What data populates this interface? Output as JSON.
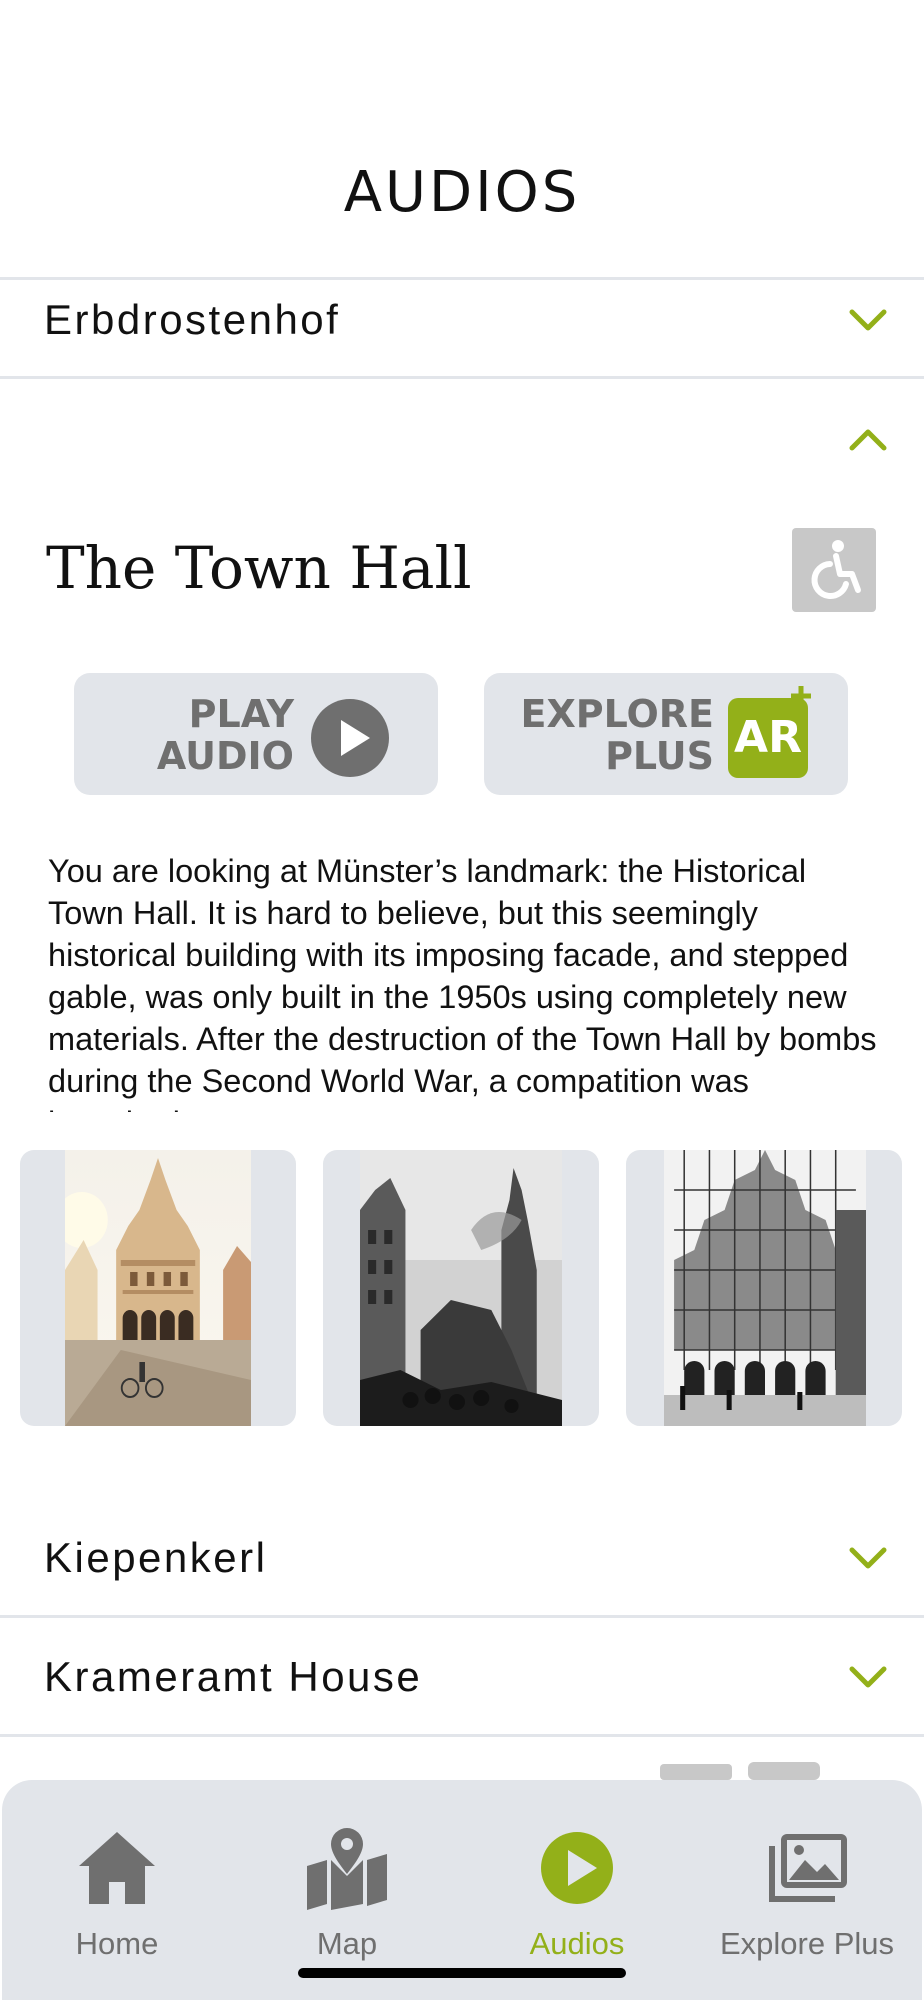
{
  "header": {
    "title": "AUDIOS"
  },
  "accordion": {
    "items": [
      {
        "label": "Erbdrostenhof",
        "state": "collapsed"
      },
      {
        "label": "The Town Hall",
        "state": "expanded"
      },
      {
        "label": "Kiepenkerl",
        "state": "collapsed"
      },
      {
        "label": "Krameramt House",
        "state": "collapsed"
      }
    ]
  },
  "town_hall": {
    "title": "The Town Hall",
    "accessibility_icon": "wheelchair-icon",
    "play_button": {
      "line1": "PLAY",
      "line2": "AUDIO",
      "icon": "play-circle-icon"
    },
    "explore_button": {
      "line1": "EXPLORE",
      "line2": "PLUS",
      "badge": "AR",
      "icon": "ar-plus-badge-icon"
    },
    "description": "You are looking at Münster’s landmark: the Historical Town Hall. It is hard to believe, but this seemingly historical building with its imposing facade, and stepped gable, was only built in the 1950s using completely new materials. After the destruction of the Town Hall by bombs during the Second World War, a compatition was launched...",
    "gallery": [
      {
        "icon": "town-hall-photo-color"
      },
      {
        "icon": "town-hall-ruins-photo-bw"
      },
      {
        "icon": "town-hall-scaffolding-photo-bw"
      }
    ]
  },
  "tabbar": {
    "tabs": [
      {
        "label": "Home",
        "icon": "home-icon",
        "active": false
      },
      {
        "label": "Map",
        "icon": "map-icon",
        "active": false
      },
      {
        "label": "Audios",
        "icon": "play-icon",
        "active": true
      },
      {
        "label": "Explore Plus",
        "icon": "images-icon",
        "active": false
      }
    ]
  },
  "colors": {
    "accent": "#93b019",
    "button_bg": "#e2e5ea",
    "icon_gray": "#6f6f6f",
    "text": "#111111",
    "divider": "#e2e5ea"
  }
}
